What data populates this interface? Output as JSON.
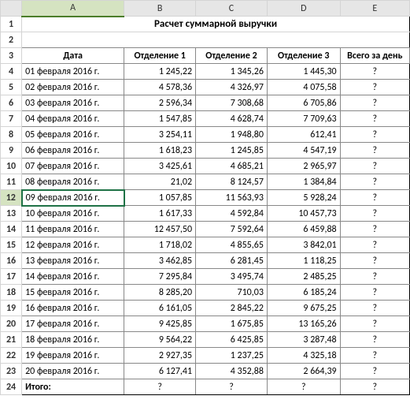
{
  "columns": [
    "A",
    "B",
    "C",
    "D",
    "E"
  ],
  "col_widths": [
    "w-a",
    "w-b",
    "w-c",
    "w-d",
    "w-e"
  ],
  "title": "Расчет суммарной выручки",
  "headers": [
    "Дата",
    "Отделение 1",
    "Отделение 2",
    "Отделение 3",
    "Всего за день"
  ],
  "rows": [
    {
      "date": "01 февраля 2016 г.",
      "v": [
        "1 245,22",
        "1 345,26",
        "1 445,30"
      ],
      "total": "?"
    },
    {
      "date": "02 февраля 2016 г.",
      "v": [
        "4 578,36",
        "4 326,97",
        "4 075,58"
      ],
      "total": "?"
    },
    {
      "date": "03 февраля 2016 г.",
      "v": [
        "2 596,34",
        "7 308,68",
        "6 705,86"
      ],
      "total": "?"
    },
    {
      "date": "04 февраля 2016 г.",
      "v": [
        "1 547,85",
        "4 628,74",
        "7 709,63"
      ],
      "total": "?"
    },
    {
      "date": "05 февраля 2016 г.",
      "v": [
        "3 254,11",
        "1 948,80",
        "612,41"
      ],
      "total": "?"
    },
    {
      "date": "06 февраля 2016 г.",
      "v": [
        "1 618,23",
        "1 245,85",
        "4 547,19"
      ],
      "total": "?"
    },
    {
      "date": "07 февраля 2016 г.",
      "v": [
        "3 425,61",
        "4 685,21",
        "2 965,97"
      ],
      "total": "?"
    },
    {
      "date": "08 февраля 2016 г.",
      "v": [
        "21,02",
        "8 124,57",
        "1 384,84"
      ],
      "total": "?"
    },
    {
      "date": "09 февраля 2016 г.",
      "v": [
        "1 057,85",
        "11 563,93",
        "5 928,24"
      ],
      "total": "?"
    },
    {
      "date": "10 февраля 2016 г.",
      "v": [
        "1 617,33",
        "4 592,84",
        "10 457,73"
      ],
      "total": "?"
    },
    {
      "date": "11 февраля 2016 г.",
      "v": [
        "12 457,50",
        "7 592,64",
        "6 459,88"
      ],
      "total": "?"
    },
    {
      "date": "12 февраля 2016 г.",
      "v": [
        "1 718,02",
        "4 855,65",
        "3 842,01"
      ],
      "total": "?"
    },
    {
      "date": "13 февраля 2016 г.",
      "v": [
        "3 462,85",
        "6 281,45",
        "1 118,25"
      ],
      "total": "?"
    },
    {
      "date": "14 февраля 2016 г.",
      "v": [
        "7 295,84",
        "3 495,74",
        "2 485,25"
      ],
      "total": "?"
    },
    {
      "date": "15 февраля 2016 г.",
      "v": [
        "8 285,20",
        "710,03",
        "6 185,24"
      ],
      "total": "?"
    },
    {
      "date": "16 февраля 2016 г.",
      "v": [
        "6 161,05",
        "2 845,22",
        "9 675,25"
      ],
      "total": "?"
    },
    {
      "date": "17 февраля 2016 г.",
      "v": [
        "9 425,85",
        "1 675,85",
        "13 165,26"
      ],
      "total": "?"
    },
    {
      "date": "18 февраля 2016 г.",
      "v": [
        "9 564,22",
        "6 425,85",
        "3 287,48"
      ],
      "total": "?"
    },
    {
      "date": "19 февраля 2016 г.",
      "v": [
        "2 927,35",
        "1 237,25",
        "4 325,18"
      ],
      "total": "?"
    },
    {
      "date": "20 февраля 2016 г.",
      "v": [
        "6 127,41",
        "4 352,88",
        "2 664,39"
      ],
      "total": "?"
    }
  ],
  "footer": {
    "label": "Итого:",
    "v": [
      "?",
      "?",
      "?"
    ],
    "total": "?"
  },
  "selected_row": 12,
  "selected_col": "A"
}
